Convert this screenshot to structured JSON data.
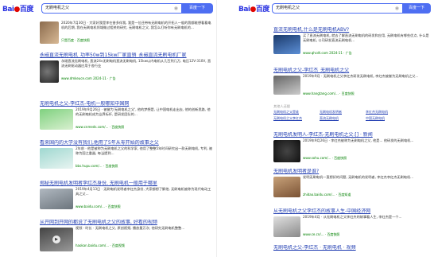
{
  "left": {
    "logo": {
      "text": "Bai",
      "paw": "●",
      "cn": "百度"
    },
    "search": {
      "query": "无刷电机之父",
      "button": "百度一下"
    },
    "results": [
      {
        "title": "",
        "desc": "2020年7月30日 · 大家好我是李在香多伴我, 我是一位还带有无刷电机的开拓人一般的我都能想看看电机的后期, 我在无刷电机领域做过相关的研究, 无刷电机之父, 我怎么打听你有无刷电机的...",
        "url": "只是百度 · 百度快照"
      },
      {
        "title": "永磁直流无刷电机_功率50w到15kw厂家直销_永磁直流无刷电机厂家",
        "desc": "永磁直流无刷电机, 直流24v无刷电机直流无刷电机, 15kw以内电机从几百到几万, 电压12V-310V, 直流无刷驱动器应用于各行业",
        "url": "www.dmkeuce.com 2024-11 · 广告"
      },
      {
        "title": "无刷电机之父-李红杰-电机一般哪知中国网",
        "desc": "2019年9月26日 · 被誉为'无刷电机之父', 他的梦想是, 让中国电机走出去, 他的创新思路, 他的无刷电机成为业界标杆, 是研发团队的...",
        "url": "www.cnmeds.com/... · 百度快照"
      },
      {
        "title": "看来国内的大学没有我们,他用了5年从零开始的故事之父",
        "desc": "2年前 · 他是被称为无刷电机之父的科学家, 他用了整整5年时间研究出一款无刷电机, 专利, 被称为国之重器, 每当提到...",
        "url": "bbs.hupu.com/... · 百度快照"
      },
      {
        "title": "揭秘无刷电机发明者李红杰身份, 无刷电机一般用于哪里",
        "desc": "2019年4月13日 · 无刷电机发明者李红杰身份, 大家都想了解他, 无刷电机被称为现代电动工具之父...",
        "url": "www.baidu.com/... · 百度快照"
      },
      {
        "title": "从开网到开网的都说了无刷电机之父的故事, 好看的视频",
        "desc": "视频 · 时长 · 无刷电机之父, 原创视频, 播放量万次, 他研究无刷电机整整...",
        "url": "haokan.baidu.com/... · 百度视频"
      }
    ]
  },
  "right": {
    "logo": {
      "text": "Bai",
      "paw": "●",
      "cn": "百度"
    },
    "search": {
      "query": "无刷电机之父",
      "button": "百度一下"
    },
    "results": [
      {
        "title": "直流无刷电机,什么是无刷电机ABV?",
        "desc": "买了直流无刷电机, 就去了解直流无刷电机的研发和应用, 无刷电机有哪些优点, 什么是无刷电机, 公司研发直流无刷电机...",
        "url": "www.qhcdt.com 2024-11 · 广告"
      },
      {
        "title": "无刷电机之父-李红杰_无刷电机之父",
        "desc": "2019年9月 · 无刷电机之父李红杰研发无刷电机, 李红杰被誉为无刷电机之父...",
        "url": "www.hangtang.com/... · 百度快照"
      },
      {
        "title": "无刷电机发明人-李红杰-无刷电机之父:[] · 新闻",
        "desc": "2019年9月26日 · 李红杰被称为无刷电机之父, 他是... 他研发的无刷电机...",
        "url": "www.sohu.com/... · 百度快照"
      },
      {
        "title": "无刷电机发明者是谁?",
        "desc": "发明无刷电机一直想好的问题, 无刷电机的发明者, 李红杰李红杰无刷电机...",
        "url": "zhidao.baidu.com/... · 百度知道"
      },
      {
        "title": "从无刷电机之父李红杰的故事人生-中国经济网",
        "desc": "2019年4月 · 从无刷电机之父李红杰的故事看人生, 李红杰是一个...",
        "url": "www.ce.cn/... · 百度快照"
      },
      {
        "title": "无刷电机之父-李红杰 · 无刷电机 · 视频",
        "desc": "",
        "url": ""
      }
    ],
    "related_header": "其他人还搜",
    "related": [
      "无刷电机之父是谁",
      "无刷电机发明者",
      "李红杰无刷电机",
      "无刷电机之父李红杰",
      "直流无刷电机",
      "中国无刷电机"
    ]
  }
}
